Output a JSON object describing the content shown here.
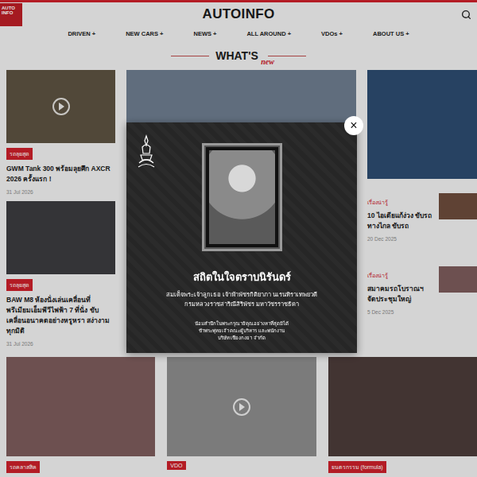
{
  "header": {
    "logo": "AUTO INFO",
    "title": "AUTOINFO"
  },
  "nav": [
    "DRIVEN +",
    "NEW CARS +",
    "NEWS +",
    "ALL AROUND +",
    "VDOs +",
    "ABOUT US +"
  ],
  "section": {
    "title": "WHAT'S",
    "script": "new"
  },
  "left_cards": [
    {
      "tag": "รถลุยสุด",
      "title": "GWM Tank 300 พร้อมลุยศึก AXCR 2026 ครั้งแรก !",
      "date": "31 Jul 2026",
      "video": true
    },
    {
      "tag": "รถลุยสุด",
      "title": "BAW M8 ห้องนั่งเล่นเคลื่อนที่ พรีเมียมเอ็มพีวีไฟฟ้า 7 ที่นั่ง ขับเคลื่อนอนาคตอย่างหรูหรา สง่างามทุกมิติ",
      "date": "31 Jul 2026",
      "video": false
    }
  ],
  "right_list": [
    {
      "tag": "เรื่องน่ารู้",
      "title": "10 ไอเดียแก้ง่วง ขับรถทางไกล ขับรถ",
      "date": "20 Dec 2025"
    },
    {
      "tag": "เรื่องน่ารู้",
      "title": "สมาคมรถโบราณฯ จัดประชุมใหญ่",
      "date": "5 Dec 2025"
    }
  ],
  "bottom_cards": [
    {
      "tag": "รถคลาสสิค",
      "video": false
    },
    {
      "tag": "VDO",
      "video": true
    },
    {
      "tag": "ยนตรกรรม (formula)",
      "video": false
    }
  ],
  "modal": {
    "close": "×",
    "title": "สถิตในใจตราบนิรันดร์",
    "lines": [
      "สมเด็จพระเจ้าลูกเธอ เจ้าฟ้าพัชรกิติยาภา นเรนทิราเทพยวดี",
      "กรมหลวงราชสาริณีสิริพัชร มหาวัชรราชธิดา"
    ],
    "footer": [
      "น้อมสำนึกในพระกรุณาธิคุณอย่างหาที่สุดมิได้",
      "ข้าพระพุทธเจ้า คณะผู้บริหาร และพนักงาน",
      "บริษัท เซียงกงยา จำกัด"
    ]
  }
}
